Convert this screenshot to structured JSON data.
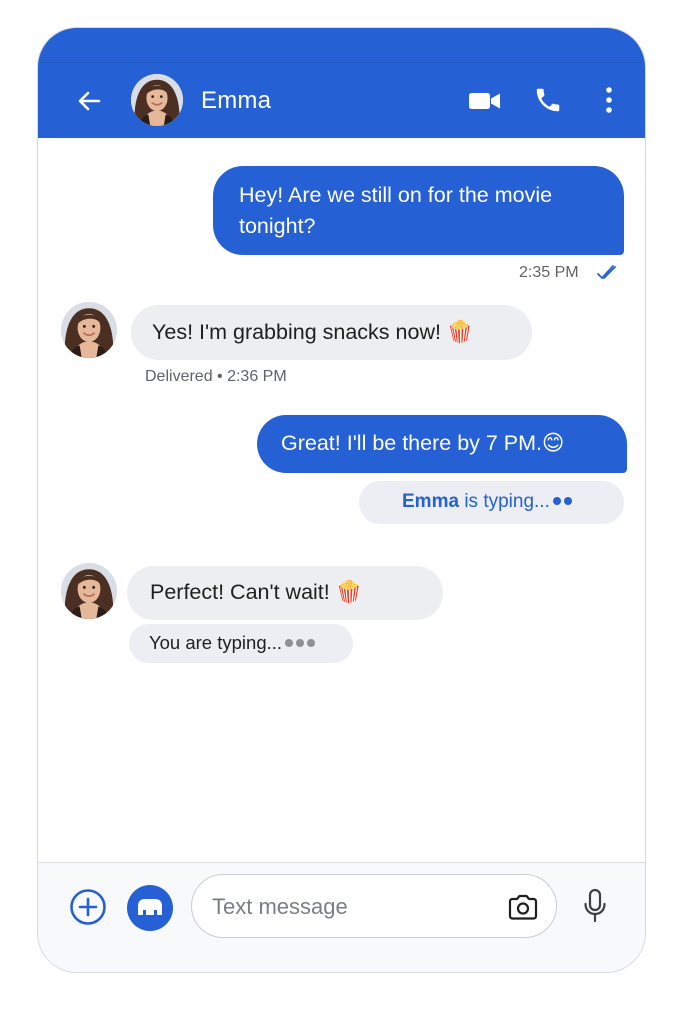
{
  "header": {
    "contact_name": "Emma",
    "back_icon": "back-arrow-icon",
    "video_icon": "video-call-icon",
    "call_icon": "phone-icon",
    "menu_icon": "more-vertical-icon",
    "background_color": "#2560d4"
  },
  "messages": [
    {
      "direction": "outgoing",
      "text": "Hey! Are we still on for the movie tonight?",
      "time": "2:35 PM",
      "status_icon": "read-check-icon"
    },
    {
      "direction": "incoming",
      "text": "Yes! I'm grabbing snacks now! 🍿",
      "status": "Delivered • 2:36 PM"
    },
    {
      "direction": "outgoing",
      "text": "Great! I'll be there by 7 PM.😊"
    },
    {
      "direction": "incoming",
      "text": "Perfect! Can't wait! 🍿"
    }
  ],
  "typing_indicators": {
    "contact": {
      "name": "Emma",
      "text": "is typing..."
    },
    "self": {
      "text": "You are typing..."
    }
  },
  "composer": {
    "placeholder": "Text message",
    "value": "",
    "add_icon": "add-circle-icon",
    "sticker_icon": "sticker-icon",
    "camera_icon": "camera-icon",
    "mic_icon": "microphone-icon"
  },
  "colors": {
    "accent": "#2560d4",
    "incoming_bubble": "#eceef1",
    "typing_bubble": "#eceef3",
    "meta_text": "#5f6368"
  }
}
